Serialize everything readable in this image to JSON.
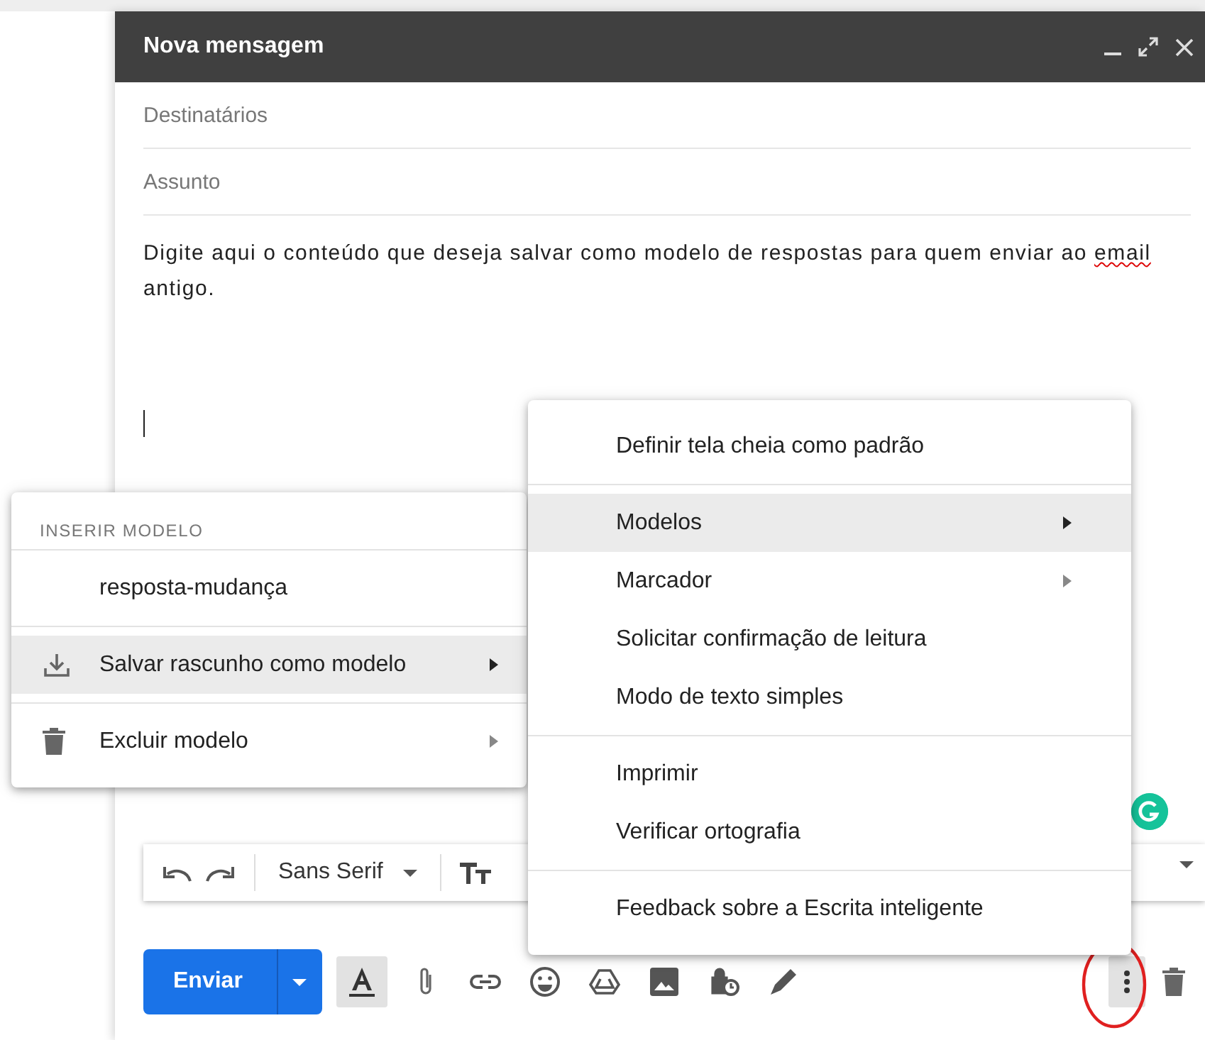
{
  "compose": {
    "title": "Nova mensagem",
    "fields": [
      {
        "placeholder": "Destinatários"
      },
      {
        "placeholder": "Assunto"
      }
    ],
    "body": [
      {
        "text": "Digite aqui o conteúdo que deseja salvar como modelo de respostas para quem enviar ao ",
        "misspelled": false
      },
      {
        "text": "email",
        "misspelled": true
      },
      {
        "text": " antigo.",
        "misspelled": false
      }
    ],
    "format_toolbar": {
      "font": "Sans Serif"
    },
    "send_label": "Enviar",
    "formatting_on": true,
    "more_open": true
  },
  "menu": {
    "sections": [
      [
        {
          "label": "Definir tela cheia como padrão",
          "submenu": false,
          "highlighted": false
        }
      ],
      [
        {
          "label": "Modelos",
          "submenu": true,
          "highlighted": true
        },
        {
          "label": "Marcador",
          "submenu": true,
          "highlighted": false
        },
        {
          "label": "Solicitar confirmação de leitura",
          "submenu": false,
          "highlighted": false
        },
        {
          "label": "Modo de texto simples",
          "submenu": false,
          "highlighted": false
        }
      ],
      [
        {
          "label": "Imprimir",
          "submenu": false,
          "highlighted": false
        },
        {
          "label": "Verificar ortografia",
          "submenu": false,
          "highlighted": false
        }
      ],
      [
        {
          "label": "Feedback sobre a Escrita inteligente",
          "submenu": false,
          "highlighted": false
        }
      ]
    ]
  },
  "submenu": {
    "header": "INSERIR MODELO",
    "sections": [
      [
        {
          "label": "resposta-mudança",
          "kind": "template",
          "submenu": false,
          "highlighted": false
        }
      ],
      [
        {
          "label": "Salvar rascunho como modelo",
          "kind": "save",
          "submenu": true,
          "highlighted": true
        }
      ],
      [
        {
          "label": "Excluir modelo",
          "kind": "delete",
          "submenu": true,
          "highlighted": false
        }
      ]
    ]
  }
}
